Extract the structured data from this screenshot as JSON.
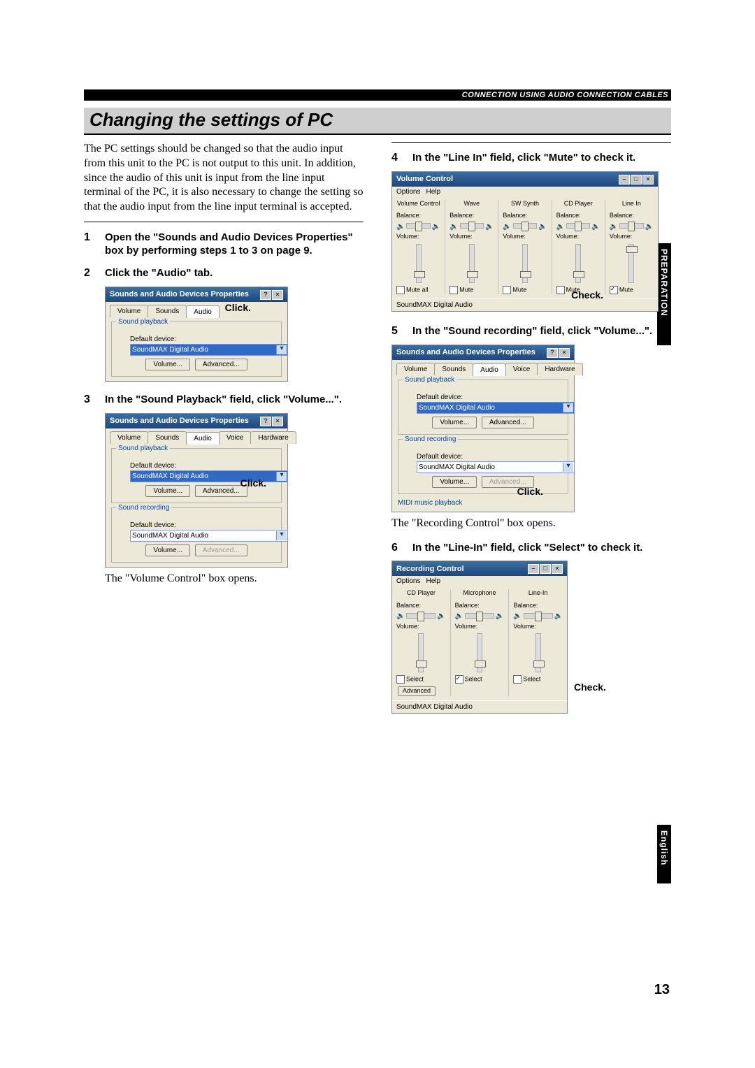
{
  "header": {
    "section": "CONNECTION USING AUDIO CONNECTION CABLES",
    "title": "Changing the settings of PC"
  },
  "thumb_tab_prep": "PREPARATION",
  "thumb_tab_eng": "English",
  "page_number": "13",
  "intro": "The PC settings should be changed so that the audio input from this unit to the PC is not output to this unit. In addition, since the audio of this unit is input from the line input terminal of the PC, it is also necessary to change the setting so that the audio input from the line input terminal is accepted.",
  "steps": {
    "s1": {
      "num": "1",
      "txt": "Open the \"Sounds and Audio Devices Properties\" box by performing steps 1 to 3 on page 9."
    },
    "s2": {
      "num": "2",
      "txt": "Click the \"Audio\" tab."
    },
    "s3": {
      "num": "3",
      "txt": "In the \"Sound Playback\" field, click \"Volume...\"."
    },
    "s3_below": "The \"Volume Control\" box opens.",
    "s4": {
      "num": "4",
      "txt": "In the \"Line In\" field, click \"Mute\" to check it."
    },
    "s5": {
      "num": "5",
      "txt": "In the \"Sound recording\" field, click \"Volume...\"."
    },
    "s5_below": "The \"Recording Control\" box opens.",
    "s6": {
      "num": "6",
      "txt": "In the \"Line-In\" field, click \"Select\" to check it."
    }
  },
  "callouts": {
    "click": "Click.",
    "check": "Check."
  },
  "props_dialog": {
    "title": "Sounds and Audio Devices Properties",
    "tabs": {
      "volume": "Volume",
      "sounds": "Sounds",
      "audio": "Audio",
      "voice": "Voice",
      "hardware": "Hardware"
    },
    "group_playback": "Sound playback",
    "group_recording": "Sound recording",
    "group_midi": "MIDI music playback",
    "default_device": "Default device:",
    "device": "SoundMAX Digital Audio",
    "btn_volume": "Volume...",
    "btn_advanced": "Advanced..."
  },
  "volctrl": {
    "title": "Volume Control",
    "menu_options": "Options",
    "menu_help": "Help",
    "status": "SoundMAX Digital Audio",
    "cols": {
      "c1": "Volume Control",
      "c2": "Wave",
      "c3": "SW Synth",
      "c4": "CD Player",
      "c5": "Line In"
    },
    "balance": "Balance:",
    "volume": "Volume:",
    "mute_all": "Mute all",
    "mute": "Mute"
  },
  "recctrl": {
    "title": "Recording Control",
    "menu_options": "Options",
    "menu_help": "Help",
    "status": "SoundMAX Digital Audio",
    "cols": {
      "c1": "CD Player",
      "c2": "Microphone",
      "c3": "Line-In"
    },
    "balance": "Balance:",
    "volume": "Volume:",
    "select": "Select",
    "advanced": "Advanced"
  }
}
